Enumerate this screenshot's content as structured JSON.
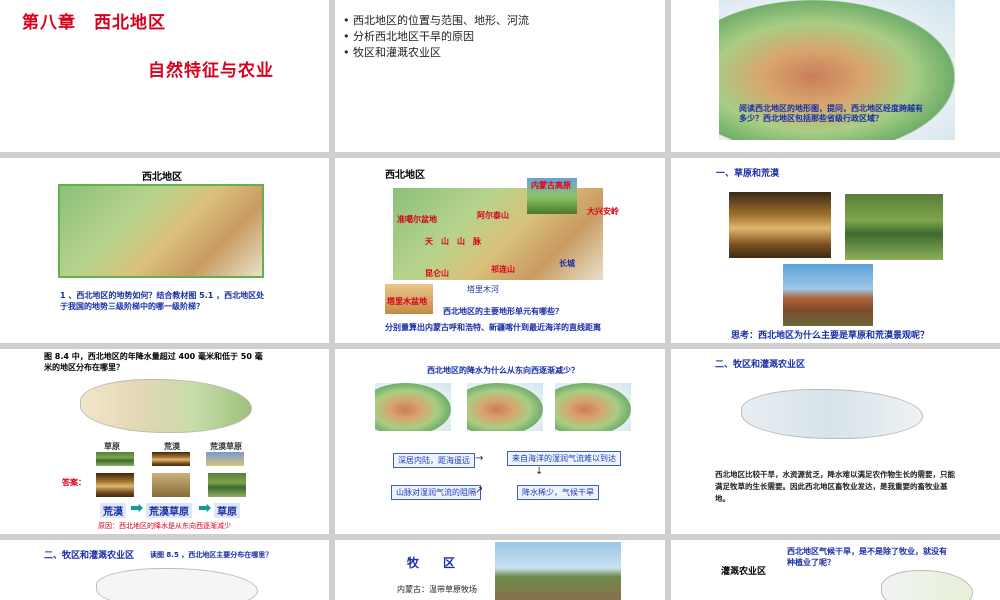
{
  "slides": {
    "s1": {
      "title": "第八章　西北地区",
      "subtitle": "自然特征与农业"
    },
    "s2": {
      "bullets": [
        "西北地区的位置与范围、地形、河流",
        "分析西北地区干旱的原因",
        "牧区和灌溉农业区"
      ]
    },
    "s3": {
      "question": "阅读西北地区的地形图，提问，西北地区经度跨越有多少？西北地区包括那些省级行政区域？"
    },
    "s4": {
      "title": "西北地区",
      "question": "1 、西北地区的地势如何？结合教材图 5.1 ，西北地区处于我国的地势三级阶梯中的哪一级阶梯？"
    },
    "s5": {
      "title": "西北地区",
      "labels": {
        "neimenggu": "内蒙古高原",
        "zhungeer": "准噶尔盆地",
        "aertaishan": "阿尔泰山",
        "tianshan": "天　山　山　脉",
        "kunlun": "昆仑山",
        "qilian": "祁连山",
        "changcheng": "长城",
        "daxinganling": "大兴安岭",
        "talimu_pendi": "塔里木盆地",
        "talimu_he": "塔里木河"
      },
      "question1": "西北地区的主要地形单元有哪些？",
      "question2": "分别量算出内蒙古呼和浩特、新疆喀什到最近海洋的直线距离"
    },
    "s6": {
      "heading": "一、草原和荒漠",
      "think": "思考：西北地区为什么主要是草原和荒漠景观呢？"
    },
    "s7": {
      "question": "图 8.4 中，西北地区的年降水量超过 400 毫米和低于 50 毫米的地区分布在哪里？",
      "labels": [
        "草原",
        "荒漠",
        "荒漠草原"
      ],
      "answer_label": "答案：",
      "sequence": [
        "荒漠",
        "荒漠草原",
        "草原"
      ],
      "reason": "原因：西北地区的降水是从东向西逐渐减少"
    },
    "s8": {
      "question": "西北地区的降水为什么从东向西逐渐减少？",
      "boxes": [
        "深居内陆，距海遥远",
        "来自海洋的湿润气流难以到达",
        "山脉对湿润气流的阻隔",
        "降水稀少，气候干旱"
      ]
    },
    "s9": {
      "heading": "二、牧区和灌溉农业区",
      "text": "西北地区比较干旱，水资源贫乏，降水难以满足农作物生长的需要，只能满足牧草的生长需要。因此西北地区畜牧业发达，是我重要的畜牧业基地。"
    },
    "s10": {
      "heading": "二、牧区和灌溉农业区",
      "question": "读图 8.5 ，西北地区主要分布在哪里？"
    },
    "s11": {
      "title": "牧　　区",
      "caption": "内蒙古：温带草原牧场"
    },
    "s12": {
      "heading": "灌溉农业区",
      "question": "西北地区气候干旱，是不是除了牧业，就没有种植业了呢？"
    }
  }
}
